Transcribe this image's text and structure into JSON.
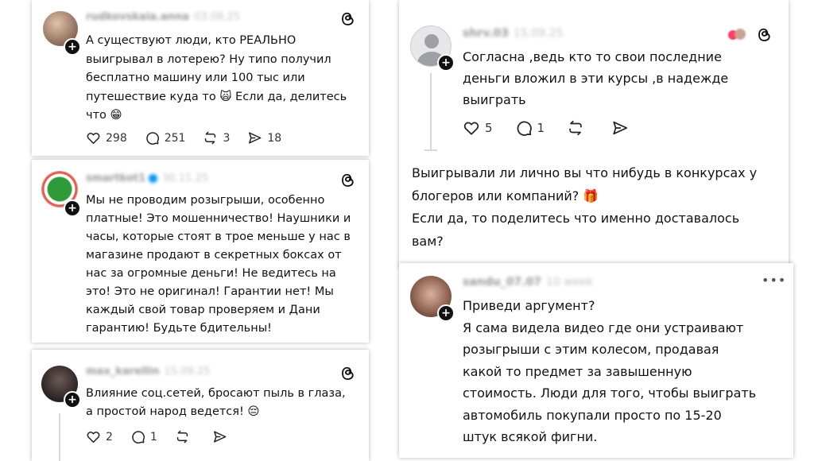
{
  "left_posts": [
    {
      "username": "rudkovskaia.anna",
      "date": "03.08.25",
      "text": "А существуют люди, кто РЕАЛЬНО\nвыигрывал в лотерею? Ну типо получил\nбесплатно машину или 100 тыс или\nпутешествие куда то 🙀 Если да, делитесь\nчто 😁",
      "likes": "298",
      "comments": "251",
      "reposts": "3",
      "shares": "18"
    },
    {
      "username": "smartkot1",
      "date": "30.11.25",
      "text": "Мы не проводим розыгрыши, особенно\nплатные! Это мошенничество! Наушники  и\nчасы, которые стоят в трое меньше у нас в\nмагазине продают в секретных боксах от\nнас за огромные деньги! Не ведитесь на\nэто! Это не оригинал! Гарантии нет! Мы\nкаждый свой товар проверяем и Дани\nгарантию! Будьте бдительны!"
    },
    {
      "username": "max_karellin",
      "date": "15.09.25",
      "text": "Влияние соц.сетей, бросают пыль в глаза,\nа простой народ ведется! 😔",
      "likes": "2",
      "comments": "1"
    }
  ],
  "right_posts": [
    {
      "username": "shrv.03",
      "date": "15.09.25",
      "text": "Согласна ,ведь кто то свои последние\nденьги вложил в эти курсы ,в надежде\nвыиграть",
      "likes": "5",
      "comments": "1"
    },
    {
      "text": "Выигрывали ли лично вы что нибудь в конкурсах у\nблогеров или компаний? 🎁\nЕсли да, то поделитесь что именно доставалось\nвам?"
    },
    {
      "username": "sandu_07.07",
      "date": "10 week",
      "text": "Приведи аргумент?\nЯ сама видела видео где они устраивают\nрозыгрыши с этим колесом, продавая\nкакой то предмет за завышенную\nстоимость. Люди для того, чтобы выиграть\nавтомобиль покупали просто по 15-20\nштук всякой фигни."
    }
  ],
  "colors": {
    "verified": "#0095f6",
    "text": "#111111",
    "muted": "#9a9a9a"
  },
  "icons": [
    "heart-icon",
    "comment-icon",
    "repost-icon",
    "share-icon",
    "threads-logo-icon",
    "follow-plus-icon",
    "more-icon"
  ]
}
